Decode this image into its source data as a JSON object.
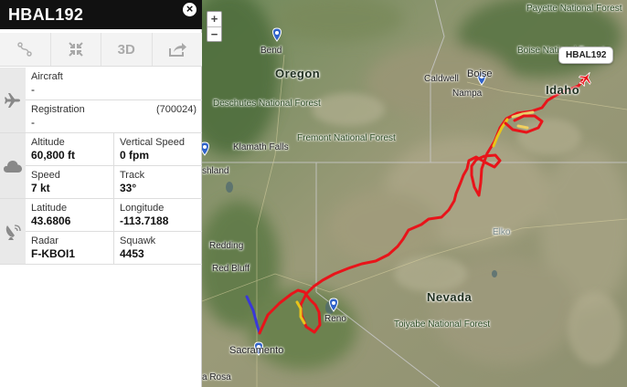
{
  "flight": {
    "callsign": "HBAL192",
    "close_label": "×",
    "tag_label": "HBAL192"
  },
  "toolbar": {
    "route_icon": "route-icon",
    "collapse_icon": "collapse-arrows-icon",
    "label_3d": "3D",
    "share_icon": "share-arrow-icon"
  },
  "aircraft": {
    "aircraft_label": "Aircraft",
    "aircraft_value": "-",
    "registration_label": "Registration",
    "registration_value": "-",
    "registration_id": "(700024)"
  },
  "weather": {
    "altitude_label": "Altitude",
    "altitude_value": "60,800 ft",
    "vspeed_label": "Vertical Speed",
    "vspeed_value": "0 fpm",
    "speed_label": "Speed",
    "speed_value": "7 kt",
    "track_label": "Track",
    "track_value": "33°"
  },
  "position": {
    "lat_label": "Latitude",
    "lat_value": "43.6806",
    "lon_label": "Longitude",
    "lon_value": "-113.7188",
    "radar_label": "Radar",
    "radar_value": "F-KBOI1",
    "squawk_label": "Squawk",
    "squawk_value": "4453"
  },
  "map": {
    "zoom_in": "+",
    "zoom_out": "−",
    "labels": {
      "payette": "Payette National Forest",
      "boise_nf": "Boise National Forest",
      "bend": "Bend",
      "oregon": "Oregon",
      "caldwell": "Caldwell",
      "boise": "Boise",
      "nampa": "Nampa",
      "idaho": "Idaho",
      "deschutes": "Deschutes National Forest",
      "fremont": "Fremont National Forest",
      "klamath": "Klamath Falls",
      "ashland": "shland",
      "elko": "Elko",
      "redding": "Redding",
      "redbluff": "Red Bluff",
      "nevada": "Nevada",
      "reno": "Reno",
      "toiyabe": "Toiyabe National Forest",
      "sacramento": "Sacramento",
      "santarosa": "a Rosa"
    },
    "colors": {
      "track_red": "#e8141a",
      "track_yellow": "#e8c41a",
      "track_blue": "#3a38d8",
      "land": "#8a9a6a"
    }
  }
}
